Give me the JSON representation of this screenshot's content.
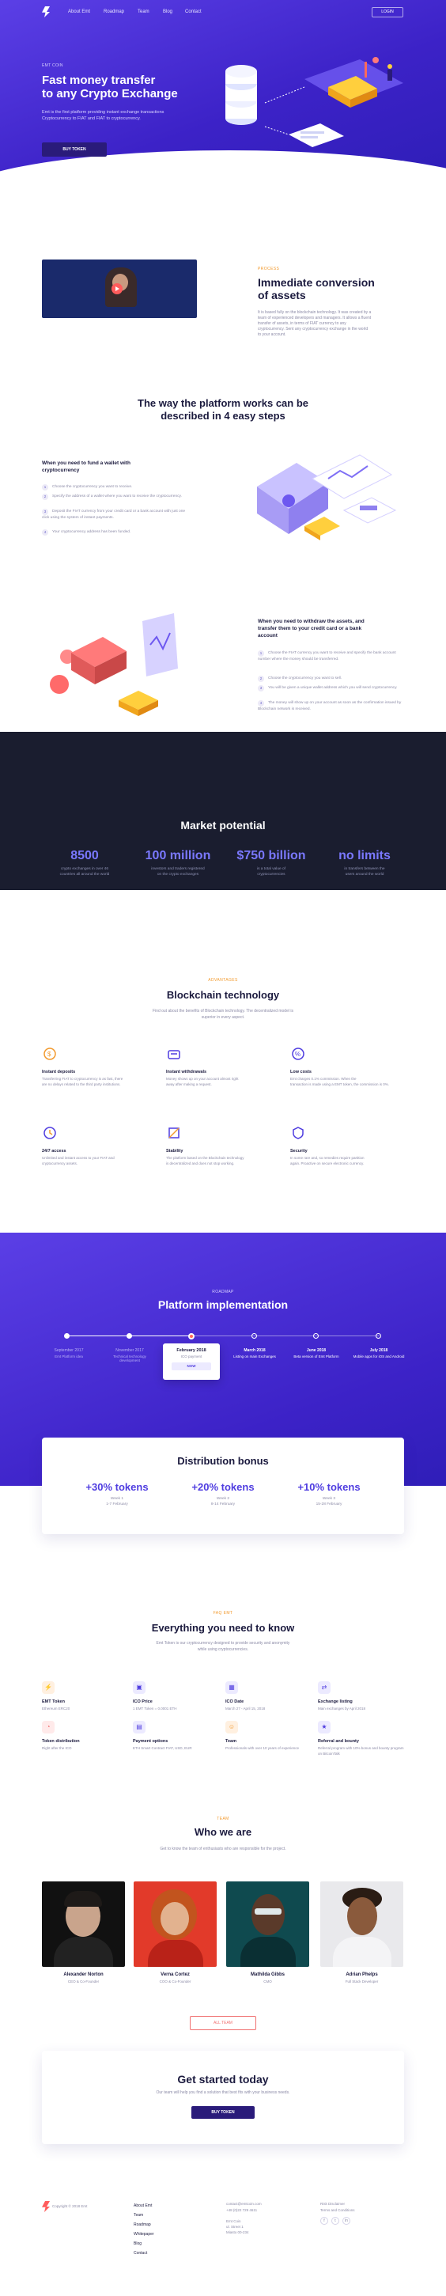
{
  "nav": {
    "links": [
      "About Emt",
      "Roadmap",
      "Team",
      "Blog",
      "Contact"
    ],
    "login": "LOGIN"
  },
  "hero": {
    "tag": "EMT COIN",
    "title_line1": "Fast money transfer",
    "title_line2": "to any Crypto Exchange",
    "lead_line1": "Emt is the first platform providing instant exchange transactions",
    "lead_line2": "Cryptocurrency to FIAT and FIAT to cryptocurrency.",
    "button": "BUY TOKEN"
  },
  "conversion": {
    "tag": "PROCESS",
    "title_line1": "Immediate conversion",
    "title_line2": "of assets",
    "text": [
      "It is based fully on the blockchain technology. It was created by a",
      "team of experienced developers and managers. It allows a fluent",
      "transfer of assets, in terms of FIAT currency to any",
      "cryptocurrency. Sent any cryptocurrency exchange in the world",
      "to your account."
    ]
  },
  "steps": {
    "title_line1": "The way the platform works can be",
    "title_line2": "described in 4 easy steps",
    "wallet": {
      "title_line1": "When you need to fund a wallet with",
      "title_line2": "cryptocurrency",
      "items": [
        "Choose the cryptocurrency you want to receive.",
        "Specify the address of a wallet where you want to receive the cryptocurrency.",
        "Deposit the FIAT currency from your credit card or a bank account with just one click using the system of instant payments.",
        "Your cryptocurrency address has been funded."
      ]
    },
    "withdraw": {
      "title_line1": "When you need to withdraw the assets, and",
      "title_line2": "transfer them to your credit card or a bank",
      "title_line3": "account",
      "items": [
        "Choose the FIAT currency you want to receive and specify the bank account number where the money should be transferred.",
        "Choose the cryptocurrency you want to sell.",
        "You will be given a unique wallet address which you will send cryptocurrency.",
        "The money will show up on your account as soon as the confirmation issued by Blockchain network is received."
      ]
    }
  },
  "market": {
    "title": "Market potential",
    "stats": [
      {
        "value": "8500",
        "label_line1": "crypto exchanges in over 46",
        "label_line2": "countries all around the world"
      },
      {
        "value": "100 million",
        "label_line1": "investors and traders registered",
        "label_line2": "on the crypto exchanges"
      },
      {
        "value": "$750 billion",
        "label_line1": "is a total value of",
        "label_line2": "cryptocurrencies"
      },
      {
        "value": "no limits",
        "label_line1": "in transfers between the",
        "label_line2": "users around the world"
      }
    ]
  },
  "blockchain": {
    "tag": "ADVANTAGES",
    "title": "Blockchain technology",
    "sub_line1": "Find out about the benefits of Blockchain technology. The decentralized model is",
    "sub_line2": "superior in every aspect.",
    "features": [
      {
        "icon": "deposit-icon",
        "title": "Instant deposits",
        "l1": "Transferring FIAT to cryptocurrency is as fast, there",
        "l2": "are no delays related to the third party institutions."
      },
      {
        "icon": "withdrawal-icon",
        "title": "Instant withdrawals",
        "l1": "Money shows up on your account almost right",
        "l2": "away after making a request."
      },
      {
        "icon": "percent-icon",
        "title": "Low costs",
        "l1": "Emt charges 0.1% commission. When the",
        "l2": "transaction is made using a EMT token, the commission is 0%."
      },
      {
        "icon": "clock-icon",
        "title": "24/7 access",
        "l1": "Unlimited and instant access to your FIAT and",
        "l2": "cryptocurrency assets."
      },
      {
        "icon": "stability-icon",
        "title": "Stability",
        "l1": "The platform based on the Blockchain technology",
        "l2": "is decentralized and does not stop working."
      },
      {
        "icon": "shield-icon",
        "title": "Security",
        "l1": "In some rare and, so remedies require partition",
        "l2": "again. Proactive on secure electronic currency."
      }
    ]
  },
  "roadmap": {
    "tag": "ROADMAP",
    "title": "Platform implementation",
    "items": [
      {
        "date": "September 2017",
        "desc": "Emt Platform idea"
      },
      {
        "date": "November 2017",
        "desc": "Technical technology development"
      },
      {
        "date": "February 2018",
        "desc": "ICO payment",
        "badge": "NOW"
      },
      {
        "date": "March 2018",
        "desc": "Listing on main Exchanges"
      },
      {
        "date": "June 2018",
        "desc": "Beta version of Emt Platform"
      },
      {
        "date": "July 2018",
        "desc": "Mobile apps for iOS and Android"
      }
    ]
  },
  "bonus": {
    "title": "Distribution bonus",
    "items": [
      {
        "value": "+30% tokens",
        "l1": "Week 1",
        "l2": "1-7 February"
      },
      {
        "value": "+20% tokens",
        "l1": "Week 2",
        "l2": "8-14 February"
      },
      {
        "value": "+10% tokens",
        "l1": "Week 3",
        "l2": "15-28 February"
      }
    ]
  },
  "info": {
    "tag": "FAQ EMT",
    "title": "Everything you need to know",
    "sub_line1": "Emt Token is our cryptocurrency designed to provide security and anonymity",
    "sub_line2": "while using cryptocurrencies.",
    "items": [
      {
        "icon": "token-icon",
        "title": "EMT Token",
        "desc": "Ethereum ERC20"
      },
      {
        "icon": "price-icon",
        "title": "ICO Price",
        "desc": "1 EMT Token = 0.0001 ETH"
      },
      {
        "icon": "calendar-icon",
        "title": "ICO Date",
        "desc": "March 27 - April 15, 2018"
      },
      {
        "icon": "exchange-icon",
        "title": "Exchange listing",
        "desc": "Main exchanges by April 2018"
      },
      {
        "icon": "distribution-icon",
        "title": "Token distribution",
        "desc": "Right after the ICO"
      },
      {
        "icon": "payment-icon",
        "title": "Payment options",
        "desc": "ETH Smart Contract FIAT, USD, EUR"
      },
      {
        "icon": "team-icon",
        "title": "Team",
        "desc": "Professionals with over 10 years of experience"
      },
      {
        "icon": "referral-icon",
        "title": "Referral and bounty",
        "desc": "Referral program with 10% bonus and bounty program on BitcoinTalk"
      }
    ]
  },
  "team": {
    "tag": "TEAM",
    "title": "Who we are",
    "sub": "Get to know the team of enthusiasts who are responsible for the project.",
    "members": [
      {
        "name": "Alexander Norton",
        "role": "CEO & Co-Founder"
      },
      {
        "name": "Verna Cortez",
        "role": "COO & Co-Founder"
      },
      {
        "name": "Mathilda Gibbs",
        "role": "CMO"
      },
      {
        "name": "Adrian Phelps",
        "role": "Full Stack Developer"
      }
    ],
    "button": "ALL TEAM"
  },
  "started": {
    "title": "Get started today",
    "sub": "Our team will help you find a solution that best fits with your business needs.",
    "button": "BUY TOKEN"
  },
  "footer": {
    "copyright": "Copyright © 2018 Emt",
    "links": [
      "About Emt",
      "Team",
      "Roadmap",
      "Whitepaper",
      "Blog",
      "Contact"
    ],
    "contact": [
      "contact@emtcoin.com",
      "+48 (0)22 729 4611",
      "Emt Coin",
      "ul. Street 1",
      "Miasto 00-234"
    ],
    "legal": [
      "Risk Disclaimer",
      "Terms and Conditions"
    ]
  }
}
